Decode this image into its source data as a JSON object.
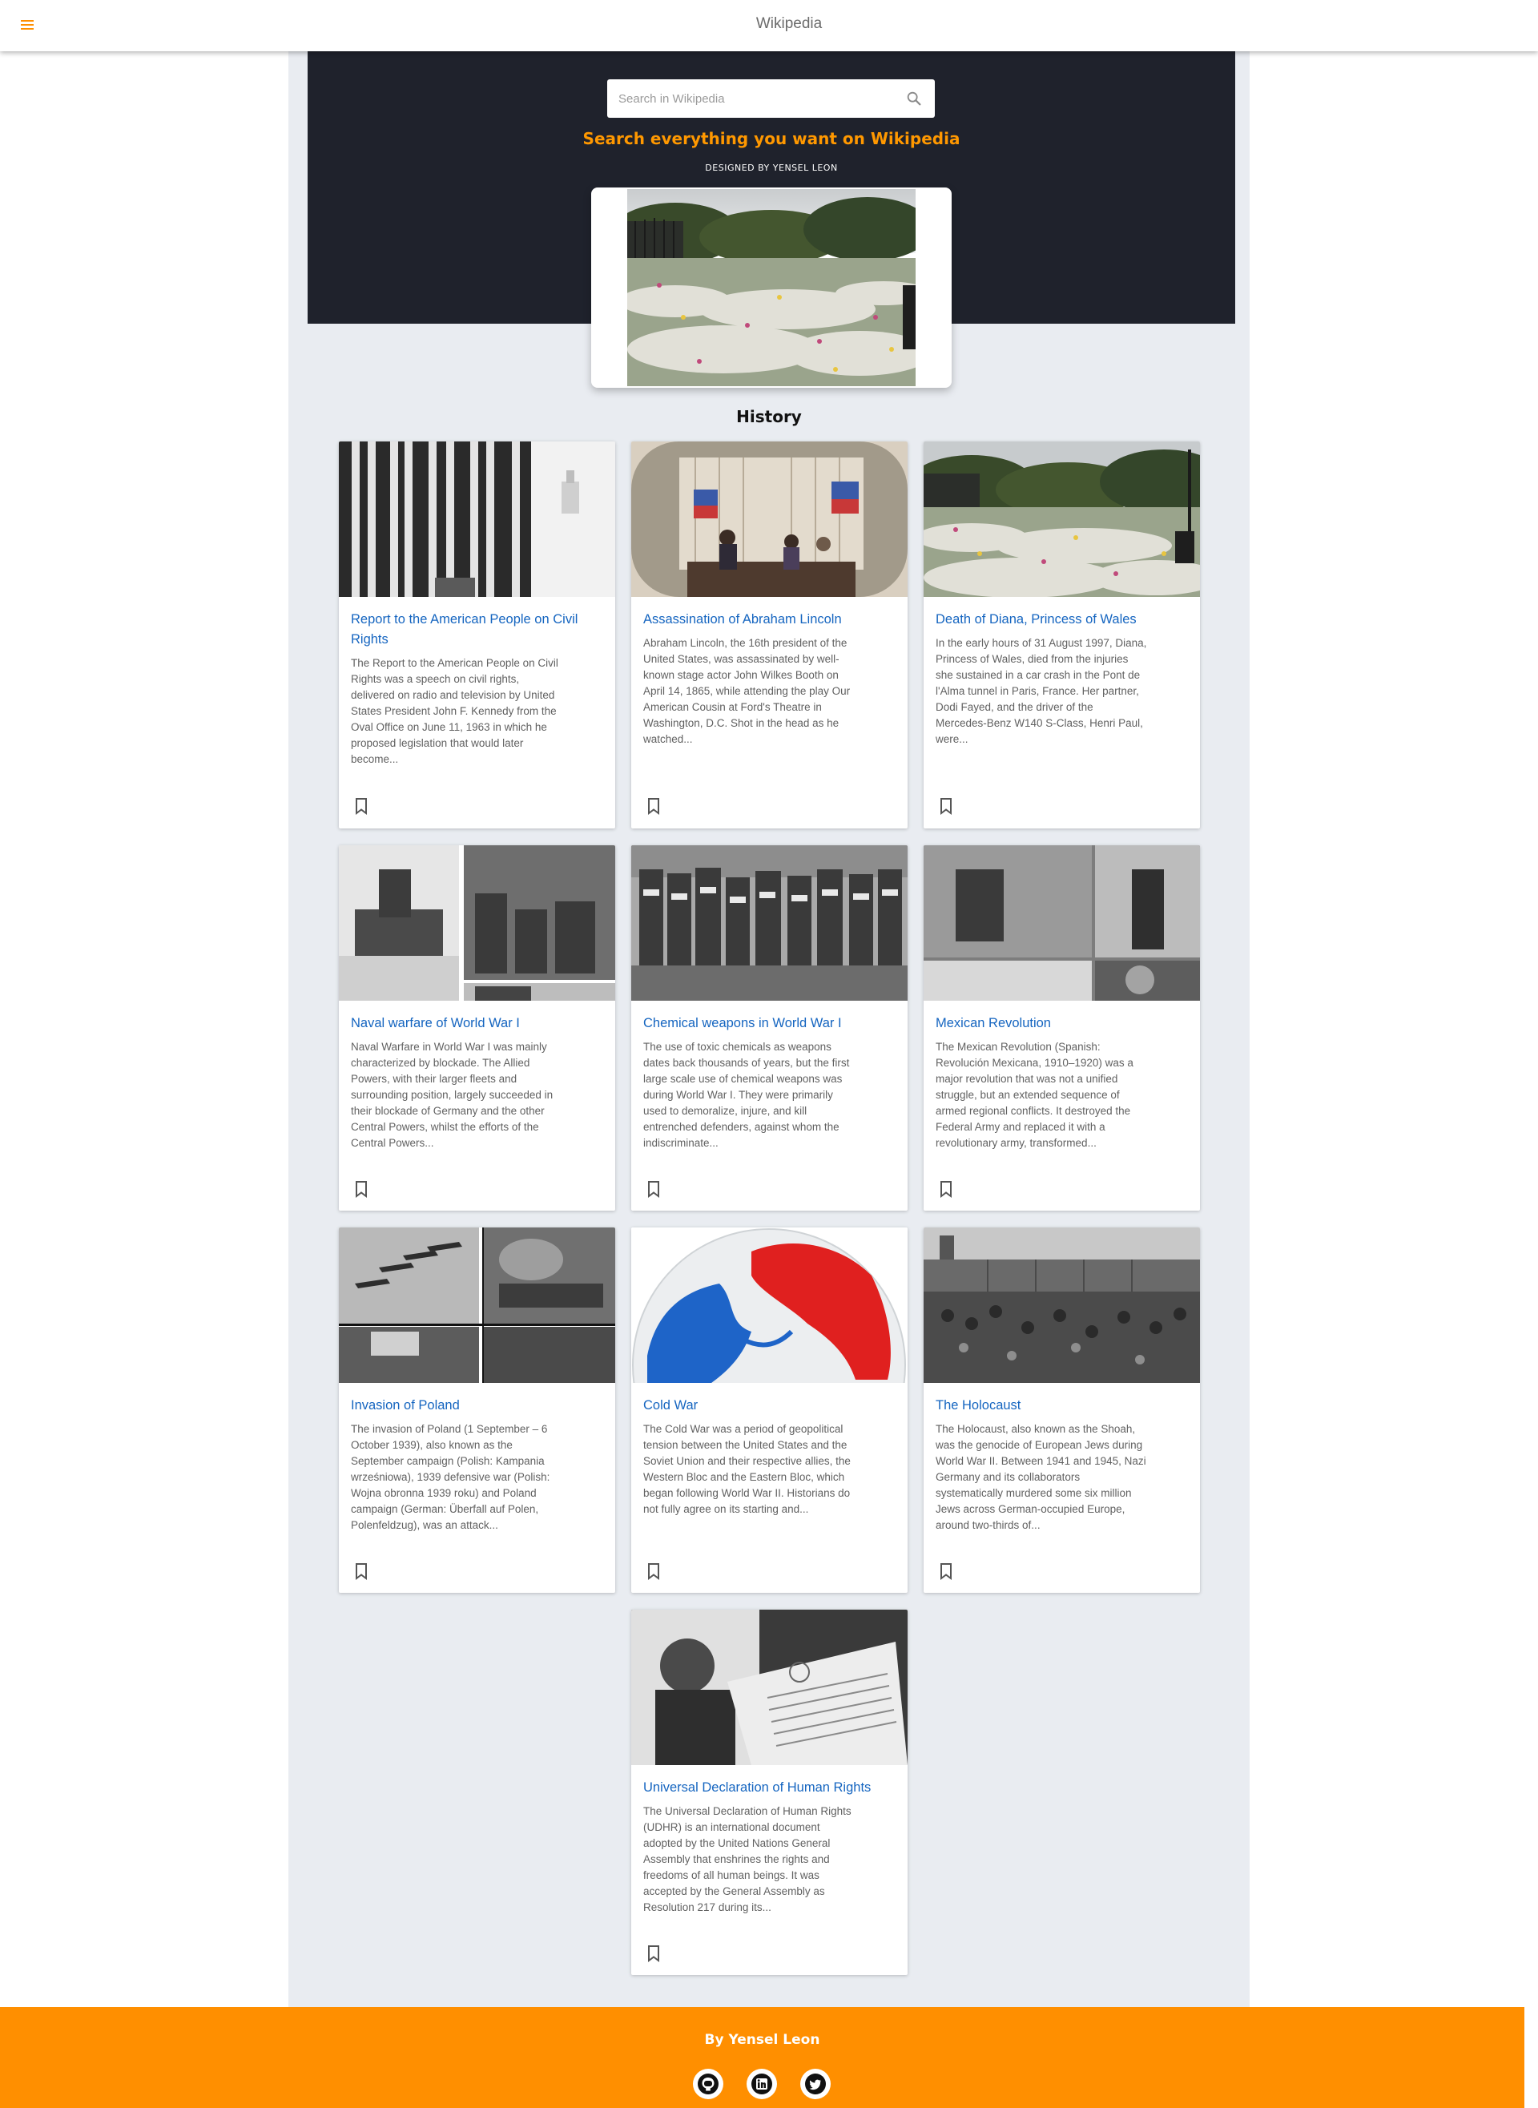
{
  "app": {
    "title": "Wikipedia"
  },
  "search": {
    "placeholder": "Search in Wikipedia",
    "value": ""
  },
  "hero": {
    "tagline": "Search everything you want on Wikipedia",
    "credit": "DESIGNED BY YENSEL LEON"
  },
  "section": {
    "title": "History"
  },
  "articles": [
    {
      "title_lines": [
        "Report to the American People on Civil",
        "Rights"
      ],
      "title": "Report to the American People on Civil Rights",
      "summary_lines": [
        "The Report to the American People on Civil",
        "Rights was a speech on civil rights,",
        "delivered on radio and television by United",
        "States President John F. Kennedy from the",
        "Oval Office on June 11, 1963 in which he",
        "proposed legislation that would later",
        "become..."
      ],
      "thumb": "curtain-window-photo",
      "bookmarked": false
    },
    {
      "title_lines": [
        "Assassination of Abraham Lincoln"
      ],
      "title": "Assassination of Abraham Lincoln",
      "summary_lines": [
        "Abraham Lincoln, the 16th president of the",
        "United States, was assassinated by well-",
        "known stage actor John Wilkes Booth on",
        "April 14, 1865, while attending the play Our",
        "American Cousin at Ford's Theatre in",
        "Washington, D.C. Shot in the head as he",
        "watched..."
      ],
      "thumb": "theatre-box-illustration",
      "bookmarked": false
    },
    {
      "title_lines": [
        "Death of Diana, Princess of Wales"
      ],
      "title": "Death of Diana, Princess of Wales",
      "summary_lines": [
        "In the early hours of 31 August 1997, Diana,",
        "Princess of Wales, died from the injuries",
        "she sustained in a car crash in the Pont de",
        "l'Alma tunnel in Paris, France. Her partner,",
        "Dodi Fayed, and the driver of the",
        "Mercedes-Benz W140 S-Class, Henri Paul,",
        "were..."
      ],
      "thumb": "flowers-at-palace-gates-photo",
      "bookmarked": false
    },
    {
      "title_lines": [
        "Naval warfare of World War I"
      ],
      "title": "Naval warfare of World War I",
      "summary_lines": [
        "Naval Warfare in World War I was mainly",
        "characterized by blockade. The Allied",
        "Powers, with their larger fleets and",
        "surrounding position, largely succeeded in",
        "their blockade of Germany and the other",
        "Central Powers, whilst the efforts of the",
        "Central Powers..."
      ],
      "thumb": "warships-collage",
      "bookmarked": false
    },
    {
      "title_lines": [
        "Chemical weapons in World War I"
      ],
      "title": "Chemical weapons in World War I",
      "summary_lines": [
        "The use of toxic chemicals as weapons",
        "dates back thousands of years, but the first",
        "large scale use of chemical weapons was",
        "during World War I. They were primarily",
        "used to demoralize, injure, and kill",
        "entrenched defenders, against whom the",
        "indiscriminate..."
      ],
      "thumb": "gassed-soldiers-photo",
      "bookmarked": false
    },
    {
      "title_lines": [
        "Mexican Revolution"
      ],
      "title": "Mexican Revolution",
      "summary_lines": [
        "The Mexican Revolution (Spanish:",
        "Revolución Mexicana, 1910–1920) was a",
        "major revolution that was not a unified",
        "struggle, but an extended sequence of",
        "armed regional conflicts. It destroyed the",
        "Federal Army and replaced it with a",
        "revolutionary army, transformed..."
      ],
      "thumb": "revolution-collage",
      "bookmarked": false
    },
    {
      "title_lines": [
        "Invasion of Poland"
      ],
      "title": "Invasion of Poland",
      "summary_lines": [
        "The invasion of Poland (1 September – 6",
        "October 1939), also known as the",
        "September campaign (Polish: Kampania",
        "wrześniowa), 1939 defensive war (Polish:",
        "Wojna obronna 1939 roku) and Poland",
        "campaign (German: Überfall auf Polen,",
        "Polenfeldzug), was an attack..."
      ],
      "thumb": "invasion-collage",
      "bookmarked": false
    },
    {
      "title_lines": [
        "Cold War"
      ],
      "title": "Cold War",
      "summary_lines": [
        "The Cold War was a period of geopolitical",
        "tension between the United States and the",
        "Soviet Union and their respective allies, the",
        "Western Bloc and the Eastern Bloc, which",
        "began following World War II. Historians do",
        "not fully agree on its starting and..."
      ],
      "thumb": "cold-war-globe-map",
      "bookmarked": false
    },
    {
      "title_lines": [
        "The Holocaust"
      ],
      "title": "The Holocaust",
      "summary_lines": [
        "The Holocaust, also known as the Shoah,",
        "was the genocide of European Jews during",
        "World War II. Between 1941 and 1945, Nazi",
        "Germany and its collaborators",
        "systematically murdered some six million",
        "Jews across German-occupied Europe,",
        "around two-thirds of..."
      ],
      "thumb": "camp-arrival-photo",
      "bookmarked": false
    },
    {
      "title_lines": [
        "Universal Declaration of Human Rights"
      ],
      "title": "Universal Declaration of Human Rights",
      "summary_lines": [
        "The Universal Declaration of Human Rights",
        "(UDHR) is an international document",
        "adopted by the United Nations General",
        "Assembly that enshrines the rights and",
        "freedoms of all human beings. It was",
        "accepted by the General Assembly as",
        "Resolution 217 during its..."
      ],
      "thumb": "declaration-poster-photo",
      "bookmarked": false
    }
  ],
  "footer": {
    "credit": "By Yensel Leon",
    "social": [
      {
        "icon": "github-icon"
      },
      {
        "icon": "linkedin-icon"
      },
      {
        "icon": "twitter-icon"
      }
    ]
  },
  "colors": {
    "accent": "#ff8f00",
    "hero": "#1f222c",
    "link": "#1565c0",
    "page": "#e9ecf1"
  }
}
